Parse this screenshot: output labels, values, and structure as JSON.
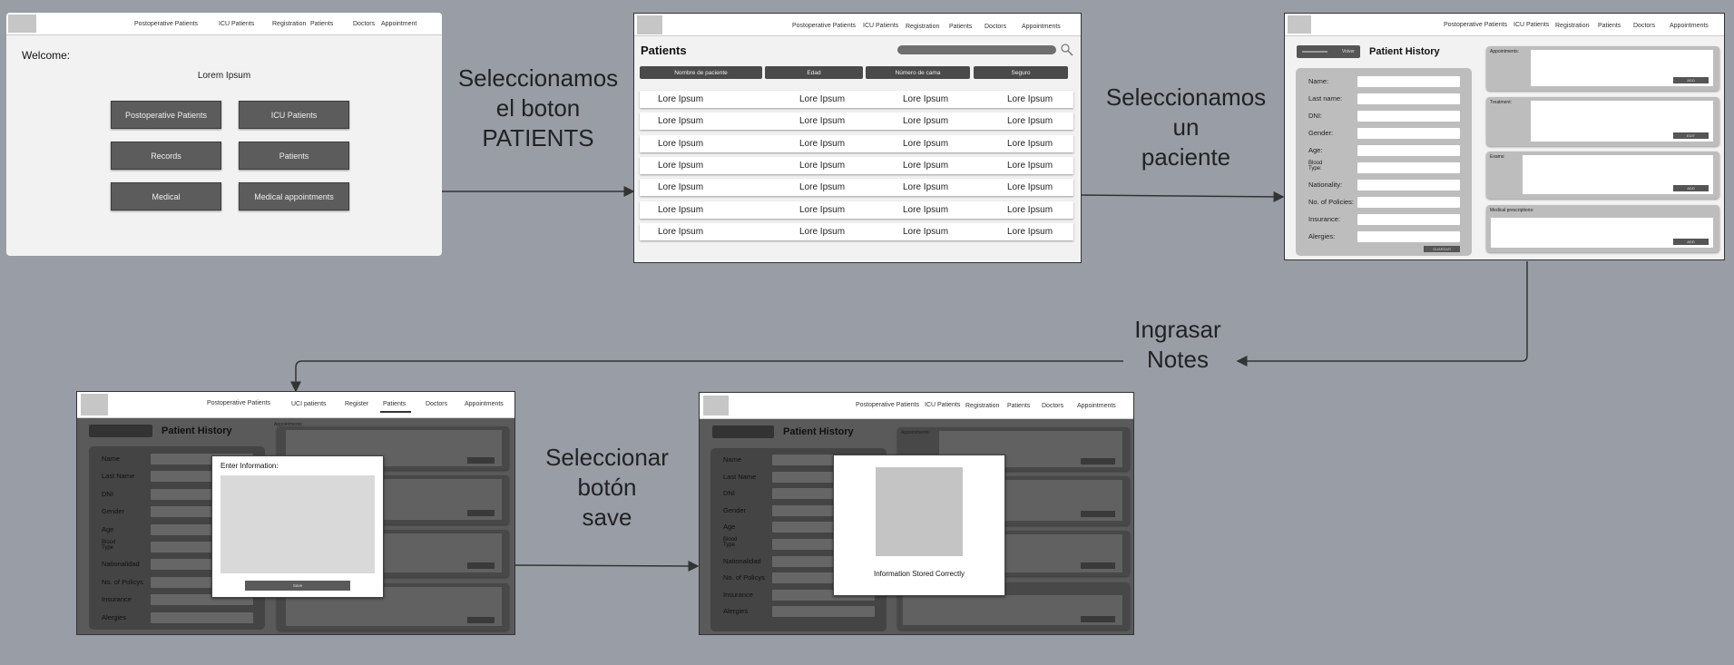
{
  "nav1": [
    "Postoperative Patients",
    "ICU Patients",
    "Registration",
    "Patients",
    "Doctors",
    "Appointment"
  ],
  "nav2": [
    "Postoperative Patients",
    "ICU Patients",
    "Registration",
    "Patients",
    "Doctors",
    "Appointments"
  ],
  "nav3": [
    "Postoperative Patients",
    "ICU Patients",
    "Registration",
    "Patients",
    "Doctors",
    "Appointments"
  ],
  "nav4": [
    "Postoperative Patients",
    "UCI patients",
    "Register",
    "Patients",
    "Doctors",
    "Appointments"
  ],
  "nav5": [
    "Postoperative Patients",
    "ICU Patients",
    "Registration",
    "Patients",
    "Doctors",
    "Appointments"
  ],
  "home": {
    "welcome": "Welcome:",
    "subtitle": "Lorem Ipsum",
    "buttons": [
      "Postoperative Patients",
      "ICU Patients",
      "Records",
      "Patients",
      "Medical",
      "Medical appointments"
    ]
  },
  "patients": {
    "title": "Patients",
    "headers": [
      "Nombre de paciente",
      "Edad",
      "Número de cama",
      "Seguro"
    ],
    "cell": "Lore Ipsum",
    "row_count": 7
  },
  "history": {
    "title": "Patient History",
    "back": "Volver",
    "labels": [
      "Name:",
      "Last name:",
      "DNI:",
      "Gender:",
      "Age:",
      "Blood Type:",
      "Nationality:",
      "No. of Policies:",
      "Insurance:",
      "Alergies:"
    ],
    "save": "GUARDAR",
    "cards": [
      "Appointments:",
      "Treatment:",
      "Exams:",
      "Medical prescriptions:"
    ],
    "card_btns": [
      "ADD",
      "EDIT",
      "ADD",
      "ADD"
    ]
  },
  "history_dim": {
    "labels": [
      "Name",
      "Last Name",
      "DNI",
      "Gender",
      "Age",
      "Blood Type",
      "Nationalidad",
      "No. of Policys",
      "Insurance",
      "Alergies"
    ],
    "cards": [
      "Appointments"
    ]
  },
  "modal1": {
    "title": "Enter Information:",
    "button": "Save"
  },
  "modal2": {
    "message": "Information Stored Correctly"
  },
  "captions": {
    "c1": [
      "Seleccionamos",
      "el boton",
      "PATIENTS"
    ],
    "c2": [
      "Seleccionamos",
      "un",
      "paciente"
    ],
    "c3": [
      "Ingrasar",
      "Notes"
    ],
    "c4": [
      "Seleccionar",
      "botón",
      "save"
    ]
  }
}
